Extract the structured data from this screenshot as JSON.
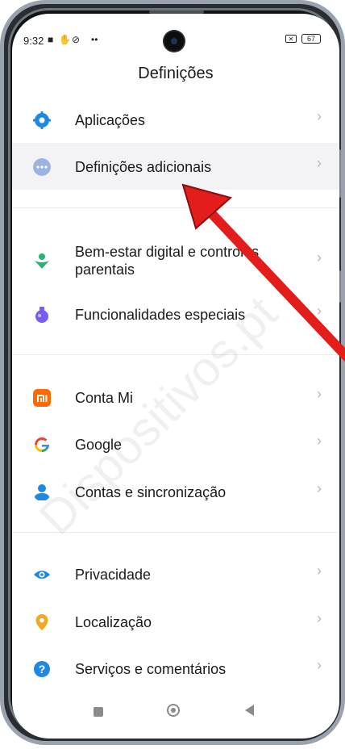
{
  "status_bar": {
    "time": "9:32",
    "battery": "67"
  },
  "header": {
    "title": "Definições"
  },
  "items": [
    {
      "label": "Aplicações",
      "icon": "gear-icon",
      "color": "#1e88e5"
    },
    {
      "label": "Definições adicionais",
      "icon": "more-dots-icon",
      "color": "#8da6d8"
    },
    {
      "label": "Bem-estar digital e controlos",
      "label2": "parentais",
      "icon": "wellbeing-icon",
      "color": "#22b573"
    },
    {
      "label": "Funcionalidades especiais",
      "icon": "flask-icon",
      "color": "#7a5cf0"
    },
    {
      "label": "Conta Mi",
      "icon": "mi-icon",
      "color": "#ff6900"
    },
    {
      "label": "Google",
      "icon": "google-icon",
      "color": "#4285f4"
    },
    {
      "label": "Contas e sincronização",
      "icon": "account-icon",
      "color": "#1e88e5"
    },
    {
      "label": "Privacidade",
      "icon": "eye-icon",
      "color": "#1e88e5"
    },
    {
      "label": "Localização",
      "icon": "location-pin-icon",
      "color": "#f5a623"
    },
    {
      "label": "Serviços e comentários",
      "icon": "help-icon",
      "color": "#1e88e5"
    }
  ],
  "watermark": "Dispositivos.pt",
  "arrow_color": "#e31c1c"
}
